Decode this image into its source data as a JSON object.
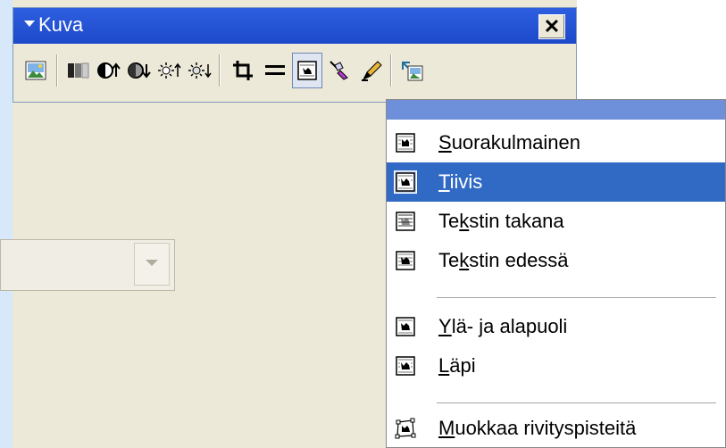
{
  "window": {
    "title": "Kuva",
    "close_label": "✕"
  },
  "toolbar": {
    "buttons": [
      {
        "name": "insert-picture-icon",
        "glyph": "🖼"
      },
      {
        "name": "color-icon",
        "glyph": "▮"
      },
      {
        "name": "more-contrast-icon",
        "glyph": "◐"
      },
      {
        "name": "less-contrast-icon",
        "glyph": "◑"
      },
      {
        "name": "more-brightness-icon",
        "glyph": "☼"
      },
      {
        "name": "less-brightness-icon",
        "glyph": "☼"
      },
      {
        "name": "crop-icon",
        "glyph": "⌗"
      },
      {
        "name": "line-style-icon",
        "glyph": "≡"
      },
      {
        "name": "text-wrapping-icon",
        "glyph": "▣"
      },
      {
        "name": "format-picture-icon",
        "glyph": "✎"
      },
      {
        "name": "set-transparent-color-icon",
        "glyph": "✐"
      },
      {
        "name": "reset-picture-icon",
        "glyph": "↺"
      }
    ]
  },
  "menu": {
    "items": [
      {
        "label": "Suorakulmainen",
        "access_key": "S",
        "icon": "square-wrap-icon"
      },
      {
        "label": "Tiivis",
        "access_key": "T",
        "icon": "tight-wrap-icon",
        "highlighted": true
      },
      {
        "label": "Tekstin takana",
        "access_key": "k",
        "icon": "behind-text-icon"
      },
      {
        "label": "Tekstin edessä",
        "access_key": "k",
        "icon": "in-front-of-text-icon"
      },
      {
        "label": "Ylä- ja alapuoli",
        "access_key": "Y",
        "icon": "top-bottom-wrap-icon"
      },
      {
        "label": "Läpi",
        "access_key": "L",
        "icon": "through-wrap-icon"
      },
      {
        "label": "Muokkaa rivityspisteitä",
        "access_key": "M",
        "icon": "edit-wrap-points-icon"
      }
    ]
  },
  "colors": {
    "titlebar": "#1d49c9",
    "highlight": "#316ac5",
    "menu_header": "#6e8fd9",
    "panel": "#ece9d8"
  }
}
